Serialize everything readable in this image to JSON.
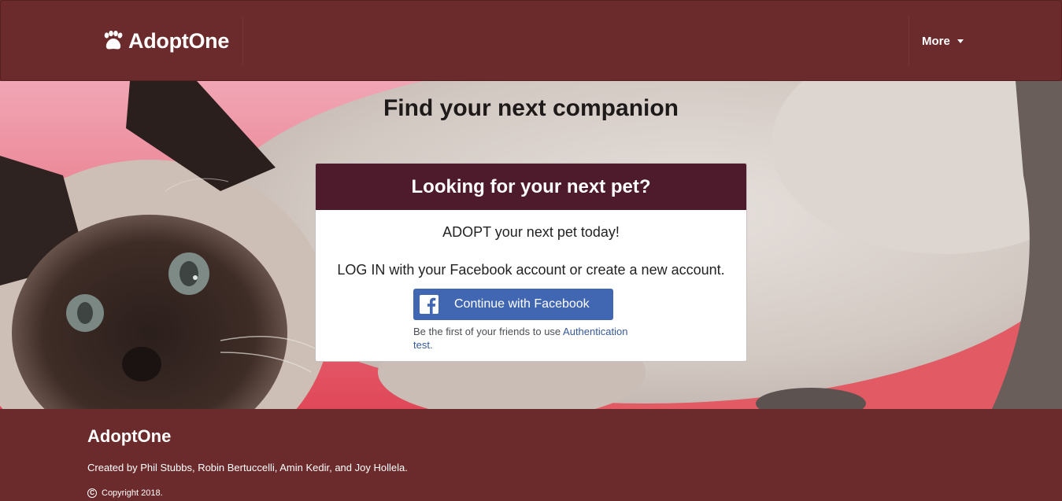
{
  "navbar": {
    "brand": "AdoptOne",
    "brand_icon": "paw-icon",
    "more_label": "More"
  },
  "hero": {
    "title": "Find your next companion"
  },
  "card": {
    "header": "Looking for your next pet?",
    "line1": "ADOPT your next pet today!",
    "line2": "LOG IN with your Facebook account or create a new account.",
    "facebook_button": "Continue with Facebook",
    "social_text": "Be the first of your friends to use ",
    "social_link": "Authentication test."
  },
  "footer": {
    "title": "AdoptOne",
    "credits": "Created by Phil Stubbs, Robin Bertuccelli, Amin Kedir, and Joy Hollela.",
    "copyright": "Copyright 2018."
  },
  "colors": {
    "brand": "#6b2a2b",
    "card_header": "#4e1b2c",
    "facebook_blue": "#4267b2",
    "link": "#365899"
  }
}
